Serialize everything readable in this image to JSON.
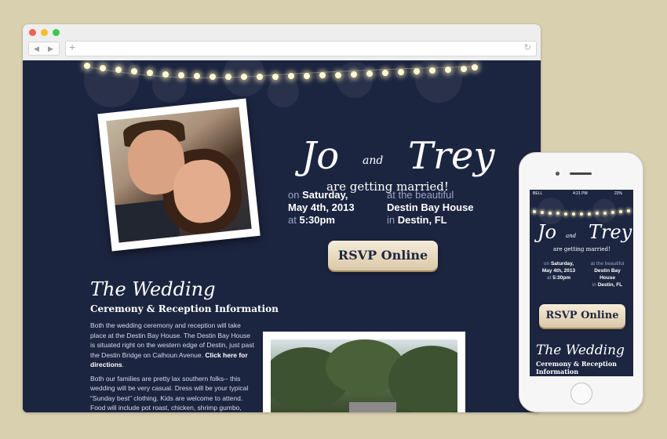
{
  "desktop": {
    "names": {
      "first": "Jo",
      "and": "and",
      "second": "Trey"
    },
    "subtitle": "are getting married!",
    "date_block": {
      "on": "on",
      "day": "Saturday,",
      "date": "May 4th, 2013",
      "at": "at",
      "time": "5:30pm"
    },
    "venue_block": {
      "at_the": "at the beautiful",
      "venue": "Destin Bay House",
      "in": "in",
      "city": "Destin, FL"
    },
    "rsvp_label": "RSVP Online",
    "wedding": {
      "title": "The Wedding",
      "subtitle": "Ceremony & Reception Information",
      "para1": "Both the wedding ceremony and reception will take place at the Destin Bay House. The Destin Bay House is situated right on the western edge of Destin, just past the Destin Bridge on Calhoun Avenue.",
      "para1_link": "Click here for directions",
      "para2": "Both our families are pretty lax southern folks-- this wedding will be very casual. Dress will be your typical “Sunday best” clothing. Kids are welcome to attend. Food will include pot roast, chicken, shrimp gumbo,"
    }
  },
  "phone": {
    "status": {
      "carrier": "BELL",
      "time": "4:21 PM",
      "battery": "22%"
    },
    "names": {
      "first": "Jo",
      "and": "and",
      "second": "Trey"
    },
    "subtitle": "are getting married!",
    "date_block": {
      "on": "on",
      "day": "Saturday,",
      "date": "May 4th, 2013",
      "at": "at",
      "time": "5:30pm"
    },
    "venue_block": {
      "at_the": "at the beautiful",
      "venue1": "Destin Bay",
      "venue2": "House",
      "in": "in",
      "city": "Destin, FL"
    },
    "rsvp_label": "RSVP Online",
    "wedding": {
      "title": "The Wedding",
      "subtitle": "Ceremony & Reception Information"
    }
  },
  "colors": {
    "page_bg": "#1c2540",
    "backdrop": "#d9d0b0",
    "button": "#f0e4cc"
  }
}
